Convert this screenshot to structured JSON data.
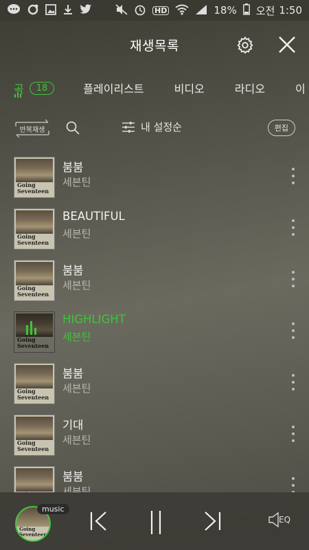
{
  "status_bar": {
    "battery": "18%",
    "ampm": "오전",
    "time": "1:50",
    "hd_label": "HD",
    "icons": [
      "chat-bubble-icon",
      "sync-icon",
      "image-icon",
      "download-icon",
      "twitter-icon",
      "mute-icon",
      "alarm-icon",
      "hd-icon",
      "wifi-icon",
      "signal-icon",
      "battery-icon"
    ]
  },
  "header": {
    "title": "재생목록",
    "settings_icon": "gear-icon",
    "close_icon": "close-icon"
  },
  "tabs": [
    {
      "label": "곡",
      "count": "18",
      "active": true
    },
    {
      "label": "플레이리스트"
    },
    {
      "label": "비디오"
    },
    {
      "label": "라디오"
    },
    {
      "label": "이"
    }
  ],
  "toolbar": {
    "repeat_label": "반복재생",
    "sort_label": "내 설정순",
    "edit_label": "편집"
  },
  "album_art_text": "Going Seventeen",
  "songs": [
    {
      "title": "붐붐",
      "artist": "세븐틴"
    },
    {
      "title": "BEAUTIFUL",
      "artist": "세븐틴"
    },
    {
      "title": "붐붐",
      "artist": "세븐틴"
    },
    {
      "title": "HIGHLIGHT",
      "artist": "세븐틴",
      "playing": true
    },
    {
      "title": "붐붐",
      "artist": "세븐틴"
    },
    {
      "title": "기대",
      "artist": "세븐틴"
    },
    {
      "title": "붐붐",
      "artist": "세븐틴"
    }
  ],
  "player": {
    "badge": "music",
    "eq_label": "EQ",
    "controls": [
      "previous-icon",
      "pause-icon",
      "next-icon"
    ]
  },
  "colors": {
    "accent": "#40c43a",
    "text": "#f2f2f2",
    "subtext": "#b9b9b3"
  }
}
